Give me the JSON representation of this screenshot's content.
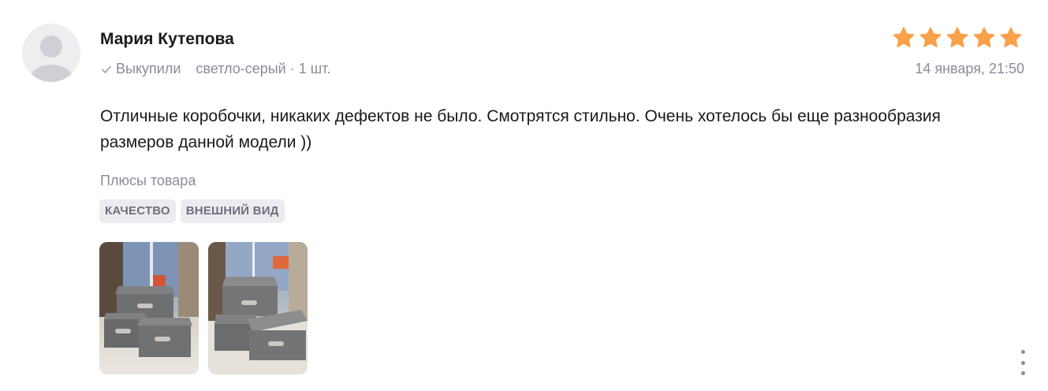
{
  "review": {
    "author": "Мария Кутепова",
    "purchase_status": "Выкупили",
    "variant": "светло-серый · 1 шт.",
    "rating": 5,
    "rating_max": 5,
    "date": "14 января, 21:50",
    "text": "Отличные коробочки, никаких дефектов не было. Смотрятся стильно. Очень хотелось бы еще разнообразия размеров данной модели ))",
    "pros_title": "Плюсы товара",
    "tags": [
      "КАЧЕСТВО",
      "ВНЕШНИЙ ВИД"
    ]
  },
  "icons": {
    "avatar": "user-placeholder-icon",
    "purchase_status": "check-icon",
    "rating": "star-icon",
    "more": "more-vertical-icon"
  },
  "colors": {
    "star": "#f7a24a",
    "muted_text": "#8a8c99",
    "tag_bg": "#ececf0",
    "avatar_bg": "#eeeef1"
  }
}
